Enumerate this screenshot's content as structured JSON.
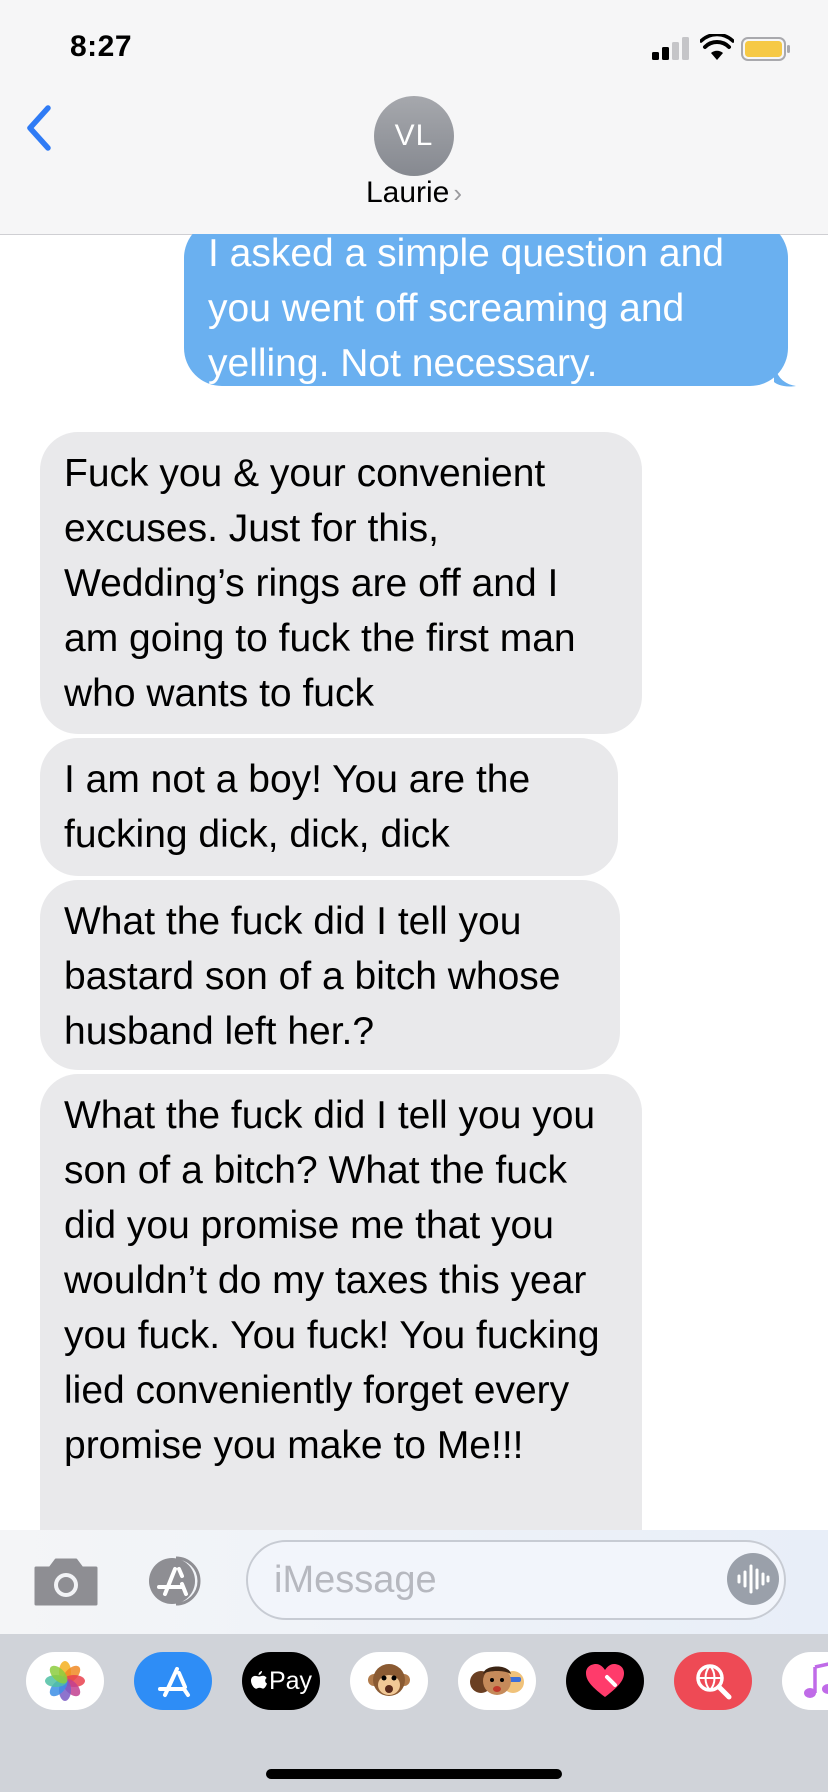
{
  "status_bar": {
    "time": "8:27"
  },
  "header": {
    "avatar_initials": "VL",
    "contact_name": "Laurie",
    "contact_chevron": "›"
  },
  "messages": [
    {
      "direction": "sent",
      "text": "I asked a simple question and you went off screaming and yelling. Not necessary."
    },
    {
      "direction": "received",
      "text": "Fuck you & your convenient excuses. Just for this, Wedding’s rings are off and I am going to fuck the first man who wants to fuck"
    },
    {
      "direction": "received",
      "text": "I am not a boy! You are the fucking dick, dick, dick"
    },
    {
      "direction": "received",
      "text": "What the fuck did I tell you bastard son of a bitch whose husband left her.?"
    },
    {
      "direction": "received",
      "text": "What the fuck did I tell you you son of a bitch? What the fuck did you promise me that you wouldn’t do my taxes this year you fuck. You fuck! You fucking lied conveniently forget every promise you make to Me!!!"
    }
  ],
  "input": {
    "placeholder": "iMessage"
  },
  "drawer": {
    "apps": [
      {
        "name": "photos",
        "label": ""
      },
      {
        "name": "app-store",
        "label": ""
      },
      {
        "name": "apple-pay",
        "label": "Pay"
      },
      {
        "name": "animoji",
        "label": ""
      },
      {
        "name": "memoji",
        "label": ""
      },
      {
        "name": "digital-touch",
        "label": ""
      },
      {
        "name": "images-search",
        "label": ""
      },
      {
        "name": "music",
        "label": ""
      }
    ]
  },
  "colors": {
    "sent_bubble": "#6ab0f0",
    "received_bubble": "#e9e9eb",
    "accent": "#2f7bf5"
  }
}
